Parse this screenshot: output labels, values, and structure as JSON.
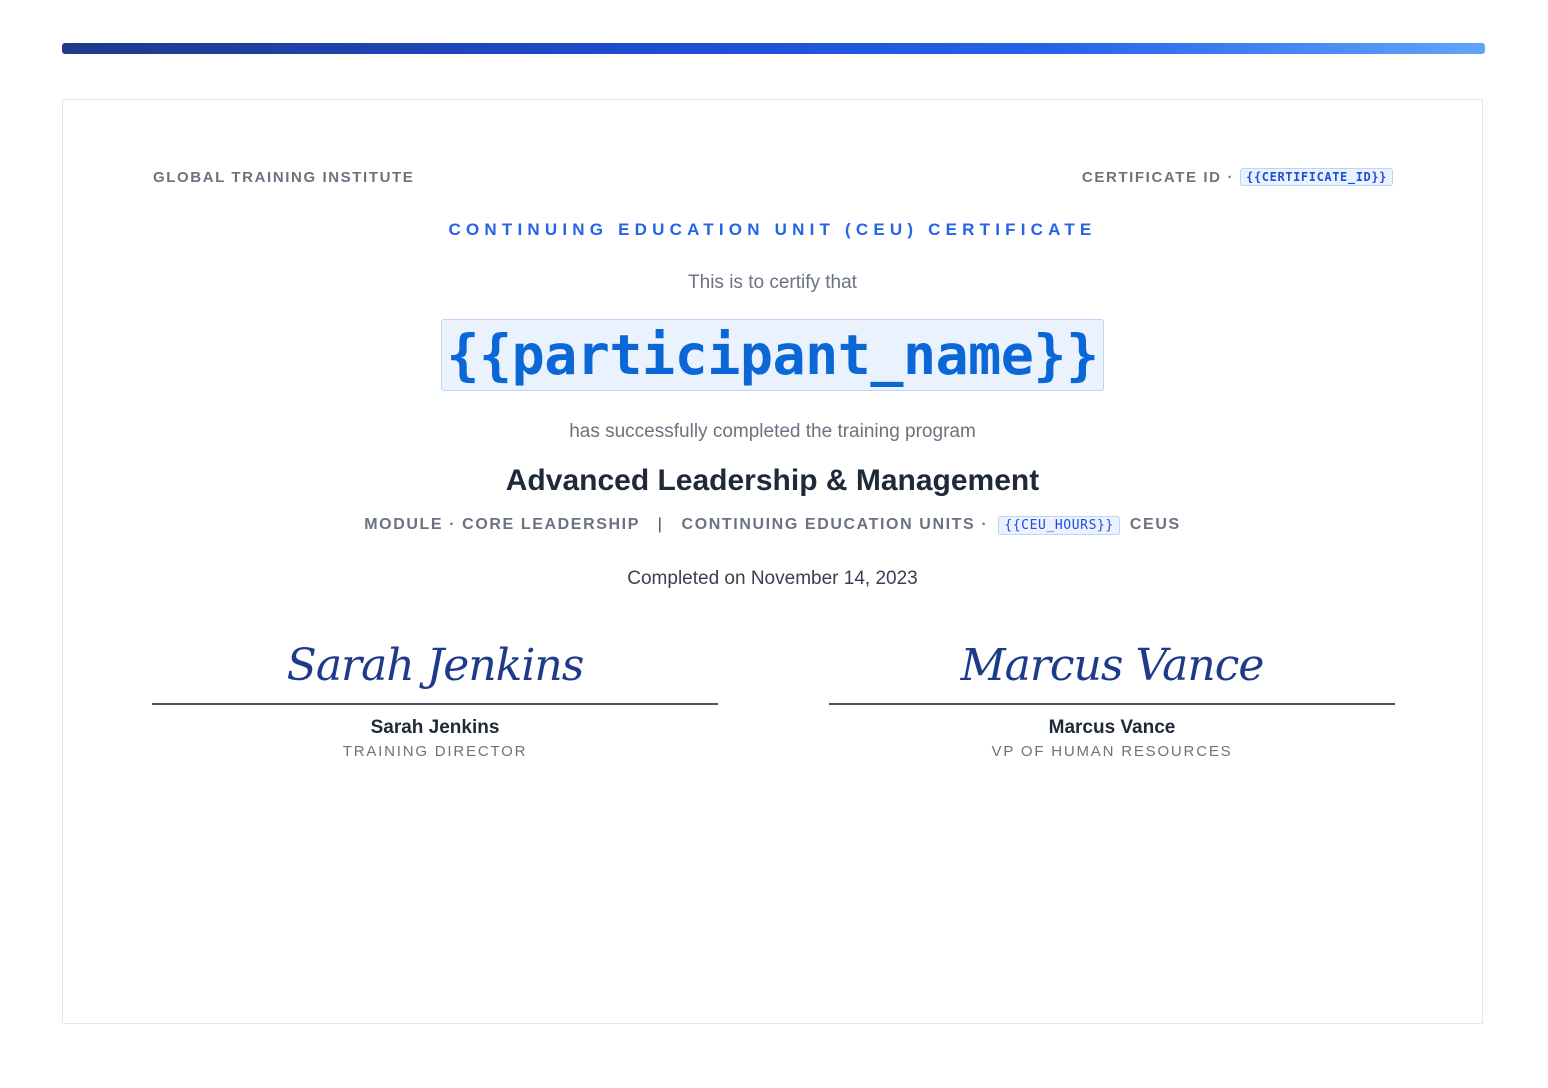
{
  "header": {
    "institute": "GLOBAL TRAINING INSTITUTE",
    "certificate_id_label": "CERTIFICATE ID",
    "certificate_id_separator": "·",
    "certificate_id_token": "{{CERTIFICATE_ID}}"
  },
  "certificate": {
    "type": "CONTINUING EDUCATION UNIT (CEU) CERTIFICATE",
    "certify_text": "This is to certify that",
    "participant_token": "{{participant_name}}",
    "completed_text": "has successfully completed the training program",
    "program_title": "Advanced Leadership & Management",
    "module_text": "MODULE · CORE LEADERSHIP",
    "meta_pipe": "|",
    "ceu_label": "CONTINUING EDUCATION UNITS ·",
    "ceu_token": "{{CEU_HOURS}}",
    "ceu_suffix": "CEUS",
    "completion_date": "Completed on November 14, 2023"
  },
  "signatures": [
    {
      "signature_script": "Sarah Jenkins",
      "name": "Sarah Jenkins",
      "role": "TRAINING DIRECTOR"
    },
    {
      "signature_script": "Marcus Vance",
      "name": "Marcus Vance",
      "role": "VP OF HUMAN RESOURCES"
    }
  ],
  "colors": {
    "accent": "#2563eb",
    "token_text": "#1d4ed8",
    "token_background": "#eaf2fd",
    "signature_ink": "#1e3a8a",
    "muted_text": "#6b7280"
  }
}
